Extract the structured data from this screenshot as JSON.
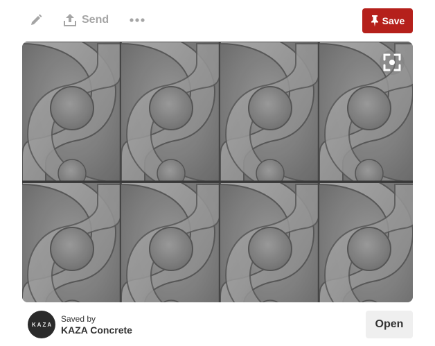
{
  "toolbar": {
    "edit_icon": "pencil-icon",
    "send_icon": "upload-icon",
    "send_label": "Send",
    "more_icon": "ellipsis-icon",
    "save_icon": "pushpin-icon",
    "save_label": "Save"
  },
  "pin": {
    "image_icon": "visual-search-icon"
  },
  "footer": {
    "avatar_logo": "KAZA",
    "saved_by_label": "Saved by",
    "board_name": "KAZA Concrete",
    "open_label": "Open"
  },
  "colors": {
    "save_button": "#b5201b",
    "open_button": "#efefef",
    "muted_icon": "#a5a5a5",
    "text": "#333333"
  }
}
